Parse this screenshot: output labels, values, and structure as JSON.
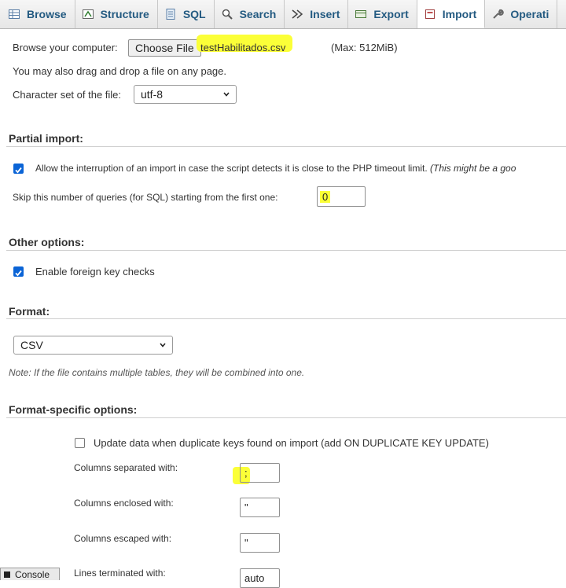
{
  "tabs": [
    {
      "label": "Browse",
      "icon": "table-icon"
    },
    {
      "label": "Structure",
      "icon": "structure-icon"
    },
    {
      "label": "SQL",
      "icon": "sql-icon"
    },
    {
      "label": "Search",
      "icon": "search-icon"
    },
    {
      "label": "Insert",
      "icon": "insert-icon"
    },
    {
      "label": "Export",
      "icon": "export-icon"
    },
    {
      "label": "Import",
      "icon": "import-icon",
      "active": true
    },
    {
      "label": "Operati",
      "icon": "wrench-icon"
    }
  ],
  "file": {
    "browse_label": "Browse your computer:",
    "choose_button": "Choose File",
    "file_name": "testHabilitados.csv",
    "max_size": "(Max: 512MiB)",
    "drag_hint": "You may also drag and drop a file on any page.",
    "charset_label": "Character set of the file:",
    "charset_value": "utf-8"
  },
  "partial": {
    "heading": "Partial import:",
    "allow_interrupt": "Allow the interruption of an import in case the script detects it is close to the PHP timeout limit.",
    "allow_interrupt_note": "(This might be a goo",
    "allow_checked": true,
    "skip_label": "Skip this number of queries (for SQL) starting from the first one:",
    "skip_value": "0"
  },
  "other": {
    "heading": "Other options:",
    "foreign_keys": "Enable foreign key checks",
    "foreign_checked": true
  },
  "format": {
    "heading": "Format:",
    "value": "CSV",
    "note": "Note: If the file contains multiple tables, they will be combined into one."
  },
  "format_specific": {
    "heading": "Format-specific options:",
    "update_dup": "Update data when duplicate keys found on import (add ON DUPLICATE KEY UPDATE)",
    "update_checked": false,
    "sep_label": "Columns separated with:",
    "sep_value": ";",
    "enclosed_label": "Columns enclosed with:",
    "enclosed_value": "\"",
    "escaped_label": "Columns escaped with:",
    "escaped_value": "\"",
    "lines_label": "Lines terminated with:",
    "lines_value": "auto"
  },
  "console_label": "Console",
  "colors": {
    "accent": "#0b64d6",
    "tab_text": "#235a81",
    "highlight": "#fbff38"
  }
}
